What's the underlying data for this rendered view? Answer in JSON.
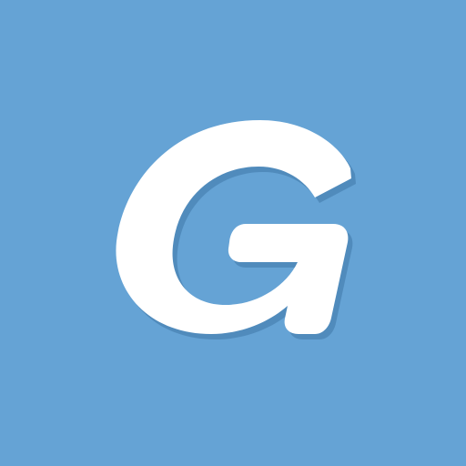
{
  "icon": {
    "name": "g-letter-logo-icon",
    "glyph": "G",
    "background_color": "#65a3d5",
    "glyph_color": "#ffffff",
    "shadow_color": "#3f78a8"
  }
}
